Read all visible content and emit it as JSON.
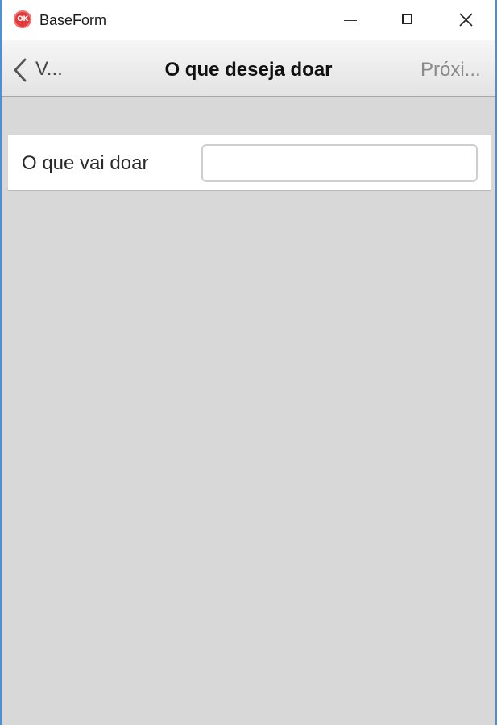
{
  "window": {
    "title": "BaseForm",
    "app_icon_text": "OK",
    "controls": [
      "minimize-icon",
      "maximize-icon",
      "close-icon"
    ]
  },
  "navbar": {
    "back_label": "V...",
    "title": "O que deseja doar",
    "next_label": "Próxi..."
  },
  "form": {
    "item_label": "O que vai doar",
    "item_value": "",
    "item_placeholder": ""
  },
  "colors": {
    "background": "#d8d8d8",
    "window_border": "#4a90d9",
    "app_icon": "#e03a3a"
  }
}
